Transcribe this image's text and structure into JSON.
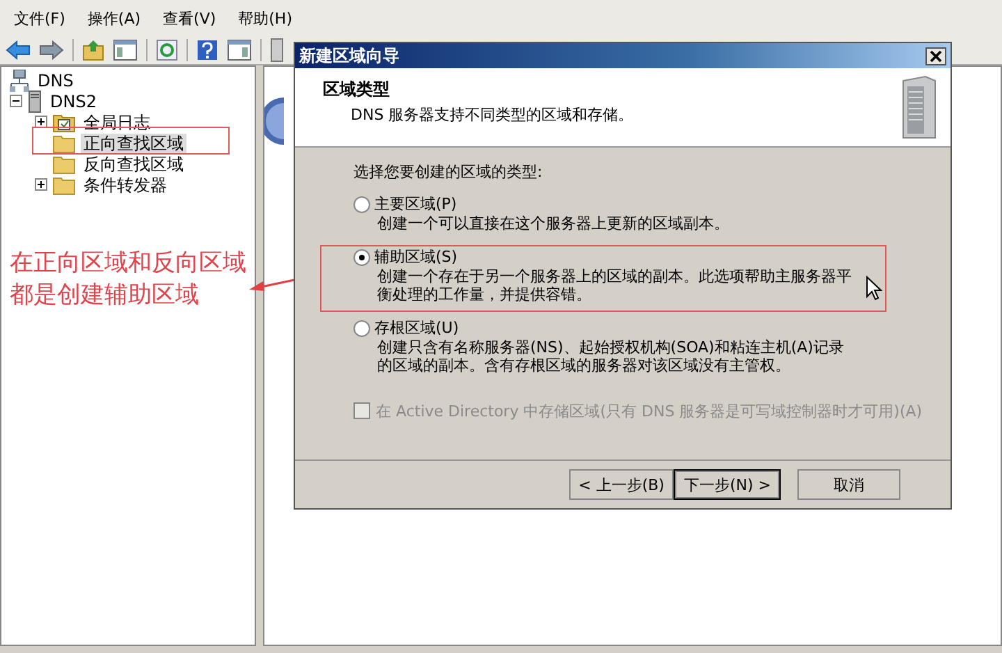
{
  "menu": [
    "文件(F)",
    "操作(A)",
    "查看(V)",
    "帮助(H)"
  ],
  "tree": {
    "label": "DNS",
    "children": [
      {
        "label": "DNS2",
        "expanded": true,
        "children": [
          {
            "label": "全局日志",
            "kind": "log",
            "expanded": false,
            "selected": false
          },
          {
            "label": "正向查找区域",
            "kind": "folder",
            "selected": true
          },
          {
            "label": "反向查找区域",
            "kind": "folder",
            "selected": false
          },
          {
            "label": "条件转发器",
            "kind": "folder",
            "expanded": false,
            "selected": false
          }
        ]
      }
    ]
  },
  "annotation": {
    "lines": [
      "在正向区域和反向区域",
      "都是创建辅助区域"
    ]
  },
  "dialog": {
    "title": "新建区域向导",
    "heading": "区域类型",
    "subtitle": "DNS 服务器支持不同类型的区域和存储。",
    "prompt": "选择您要创建的区域的类型:",
    "options": [
      {
        "label": "主要区域(P)",
        "description": "创建一个可以直接在这个服务器上更新的区域副本。",
        "selected": false
      },
      {
        "label": "辅助区域(S)",
        "description": "创建一个存在于另一个服务器上的区域的副本。此选项帮助主服务器平衡处理的工作量，并提供容错。",
        "selected": true
      },
      {
        "label": "存根区域(U)",
        "description": "创建只含有名称服务器(NS)、起始授权机构(SOA)和粘连主机(A)记录的区域的副本。含有存根区域的服务器对该区域没有主管权。",
        "selected": false
      }
    ],
    "store_in_ad": {
      "label": "在 Active Directory 中存储区域(只有 DNS 服务器是可写域控制器时才可用)(A)",
      "checked": false,
      "disabled": true
    },
    "buttons": [
      {
        "label": "< 上一步(B)",
        "default": false
      },
      {
        "label": "下一步(N) >",
        "default": true
      },
      {
        "label": "取消",
        "default": false
      }
    ]
  }
}
